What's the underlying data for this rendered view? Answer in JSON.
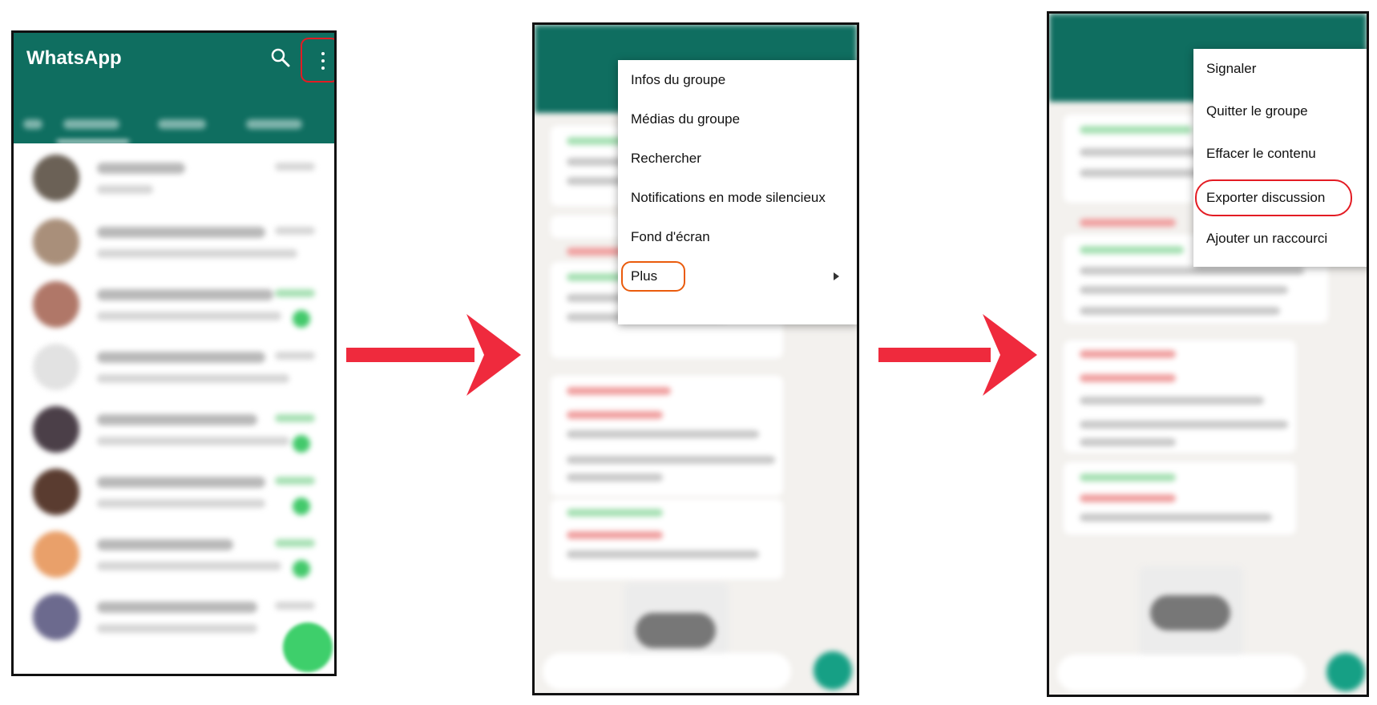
{
  "panel1": {
    "app_title": "WhatsApp",
    "icons": {
      "search": "search-icon",
      "menu": "more-vert-icon",
      "fab": "new-chat-icon"
    },
    "highlight_color": "#e31b23",
    "header_color": "#0f6e60"
  },
  "panel2": {
    "menu_items": [
      "Infos du groupe",
      "Médias du groupe",
      "Rechercher",
      "Notifications en mode silencieux",
      "Fond d'écran",
      "Plus"
    ],
    "highlight_color": "#ea5b0c"
  },
  "panel3": {
    "menu_items": [
      "Signaler",
      "Quitter le groupe",
      "Effacer le contenu",
      "Exporter discussion",
      "Ajouter un raccourci"
    ],
    "highlight_color": "#e31b23"
  },
  "arrow_color": "#ef2a3d"
}
